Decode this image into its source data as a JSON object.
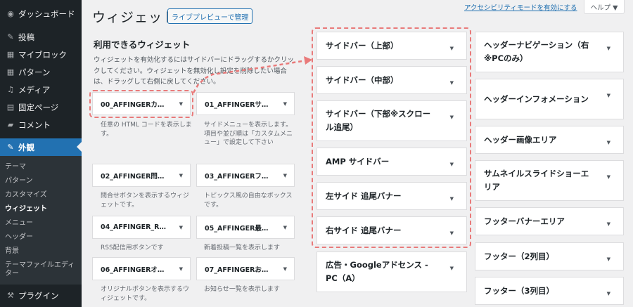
{
  "admin_menu": {
    "items": [
      {
        "label": "ダッシュボード",
        "icon": "dashboard-icon",
        "glyph": "◉"
      },
      {
        "label": "投稿",
        "icon": "pin-icon",
        "glyph": "✎"
      },
      {
        "label": "マイブロック",
        "icon": "blocks-icon",
        "glyph": "▦"
      },
      {
        "label": "パターン",
        "icon": "patterns-icon",
        "glyph": "▦"
      },
      {
        "label": "メディア",
        "icon": "media-icon",
        "glyph": "♫"
      },
      {
        "label": "固定ページ",
        "icon": "page-icon",
        "glyph": "▤"
      },
      {
        "label": "コメント",
        "icon": "comment-icon",
        "glyph": "▰"
      },
      {
        "label": "外観",
        "icon": "appearance-icon",
        "glyph": "✎"
      },
      {
        "label": "プラグイン",
        "icon": "plugin-icon",
        "glyph": "⚒"
      }
    ],
    "submenu": [
      "テーマ",
      "パターン",
      "カスタマイズ",
      "ウィジェット",
      "メニュー",
      "ヘッダー",
      "背景",
      "テーマファイルエディター"
    ]
  },
  "header": {
    "title": "ウィジェット",
    "live_preview_button": "ライブプレビューで管理",
    "accessibility_link": "アクセシビリティモードを有効にする",
    "help_button": "ヘルプ ▼"
  },
  "available": {
    "heading": "利用できるウィジェット",
    "description": "ウィジェットを有効化するにはサイドバーにドラッグするかクリックしてください。ウィジェットを無効化し設定を削除したい場合は、ドラッグして右側に戻してください。",
    "widgets": [
      {
        "title": "00_AFFINGERカ…",
        "desc": "任意の HTML コードを表示します。"
      },
      {
        "title": "01_AFFINGERサ…",
        "desc": "サイドメニューを表示します。項目や並び順は「カスタムメニュー」で設定して下さい"
      },
      {
        "title": "02_AFFINGER問…",
        "desc": "問合せボタンを表示するウィジェットです。"
      },
      {
        "title": "03_AFFINGERフ…",
        "desc": "トピックス風の自由なボックスです。"
      },
      {
        "title": "04_AFFINGER_R…",
        "desc": "RSS配信用ボタンです"
      },
      {
        "title": "05_AFFINGER最…",
        "desc": "新着投稿一覧を表示します"
      },
      {
        "title": "06_AFFINGERオ…",
        "desc": "オリジナルボタンを表示するウィジェットです。"
      },
      {
        "title": "07_AFFINGERお…",
        "desc": "お知らせ一覧を表示します"
      }
    ]
  },
  "areas_left": [
    "サイドバー（上部）",
    "サイドバー（中部）",
    "サイドバー（下部※スクロール追尾）",
    "AMP サイドバー",
    "左サイド 追尾バナー",
    "右サイド 追尾バナー",
    "広告・Googleアドセンス - PC（A）"
  ],
  "areas_right": [
    "ヘッダーナビゲーション（右※PCのみ）",
    "ヘッダーインフォメーション",
    "ヘッダー画像エリア",
    "サムネイルスライドショーエリア",
    "フッターバナーエリア",
    "フッター（2列目）",
    "フッター（3列目）"
  ],
  "arrow_glyph": "▼",
  "colors": {
    "admin_bg": "#1d2327",
    "active": "#2271b1",
    "highlight": "#e97a7a",
    "link": "#2271b1"
  }
}
